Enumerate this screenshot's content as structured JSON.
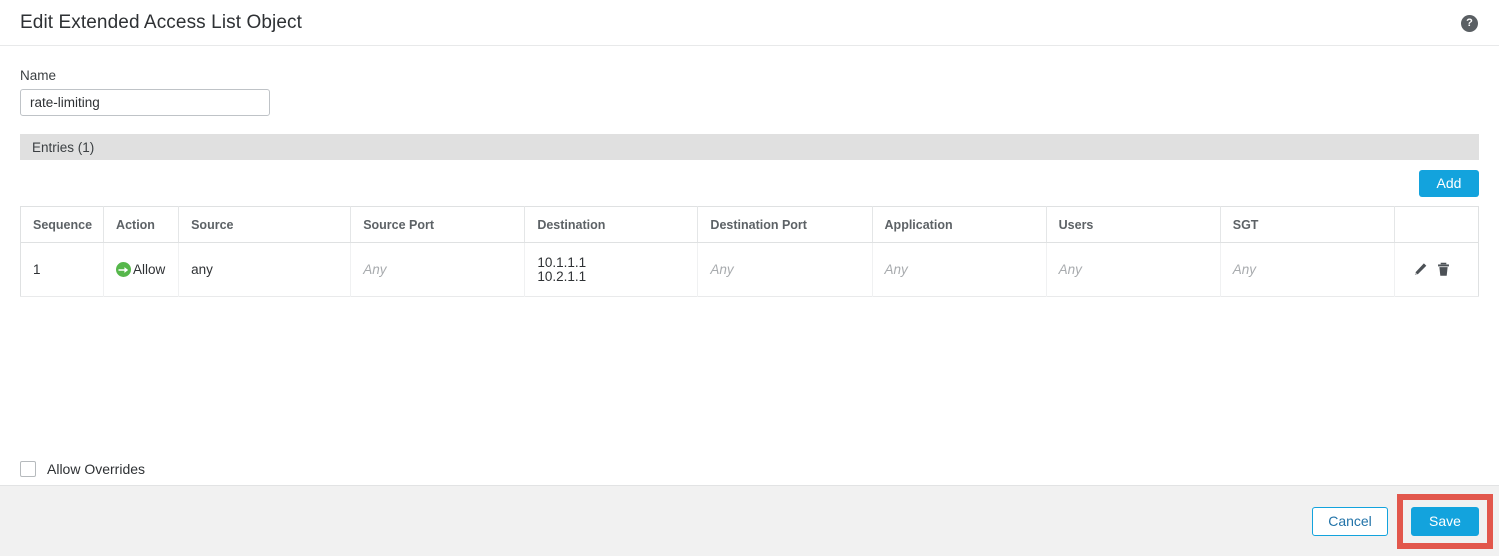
{
  "header": {
    "title": "Edit Extended Access List Object",
    "help_icon": "help-icon",
    "help_glyph": "?"
  },
  "form": {
    "name_label": "Name",
    "name_value": "rate-limiting",
    "name_placeholder": ""
  },
  "entries": {
    "section_label": "Entries (1)",
    "add_label": "Add",
    "columns": [
      "Sequence",
      "Action",
      "Source",
      "Source Port",
      "Destination",
      "Destination Port",
      "Application",
      "Users",
      "SGT",
      ""
    ],
    "rows": [
      {
        "sequence": "1",
        "action": "Allow",
        "action_icon": "allow-arrow-icon",
        "source": "any",
        "source_port": "Any",
        "destination": [
          "10.1.1.1",
          "10.2.1.1"
        ],
        "destination_port": "Any",
        "application": "Any",
        "users": "Any",
        "sgt": "Any",
        "edit_icon": "pencil-icon",
        "delete_icon": "trash-icon"
      }
    ]
  },
  "options": {
    "allow_overrides_label": "Allow Overrides",
    "allow_overrides_checked": false
  },
  "footer": {
    "cancel_label": "Cancel",
    "save_label": "Save"
  },
  "colors": {
    "accent_blue": "#13a3dd",
    "allow_green": "#56b74b",
    "highlight_red": "#e2574c",
    "section_gray": "#e0e0e0",
    "footer_gray": "#f1f1f1"
  }
}
